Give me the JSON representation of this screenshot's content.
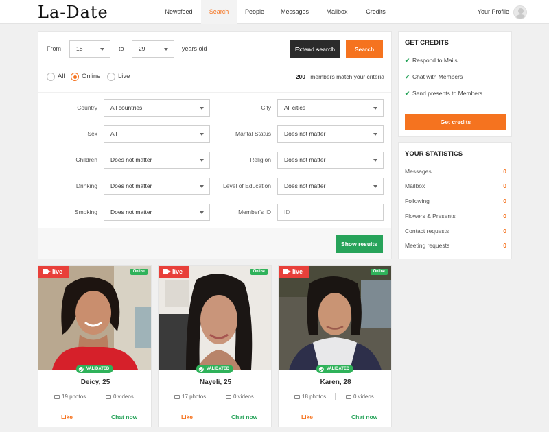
{
  "brand": {
    "logo": "La-Date"
  },
  "nav": {
    "items": [
      {
        "label": "Newsfeed",
        "active": false
      },
      {
        "label": "Search",
        "active": true
      },
      {
        "label": "People",
        "active": false
      },
      {
        "label": "Messages",
        "active": false
      },
      {
        "label": "Mailbox",
        "active": false
      },
      {
        "label": "Credits",
        "active": false
      }
    ],
    "profile_label": "Your Profile"
  },
  "search": {
    "from_label": "From",
    "age_from": "18",
    "to_label": "to",
    "age_to": "29",
    "years_label": "years old",
    "extend_button": "Extend search",
    "search_button": "Search",
    "status_options": [
      {
        "label": "All",
        "checked": false
      },
      {
        "label": "Online",
        "checked": true
      },
      {
        "label": "Live",
        "checked": false
      }
    ],
    "match_count": "200+",
    "match_text": "members match your criteria",
    "filters": {
      "country": {
        "label": "Country",
        "value": "All countries"
      },
      "city": {
        "label": "City",
        "value": "All cities"
      },
      "sex": {
        "label": "Sex",
        "value": "All"
      },
      "marital": {
        "label": "Marital Status",
        "value": "Does not matter"
      },
      "children": {
        "label": "Children",
        "value": "Does not matter"
      },
      "religion": {
        "label": "Religion",
        "value": "Does not matter"
      },
      "drinking": {
        "label": "Drinking",
        "value": "Does not matter"
      },
      "education": {
        "label": "Level of Education",
        "value": "Does not matter"
      },
      "smoking": {
        "label": "Smoking",
        "value": "Does not matter"
      },
      "member_id": {
        "label": "Member's ID",
        "placeholder": "ID"
      }
    },
    "show_results_button": "Show results"
  },
  "credits": {
    "title": "GET CREDITS",
    "items": [
      "Respond to Mails",
      "Chat with Members",
      "Send presents to Members"
    ],
    "button": "Get credits"
  },
  "stats": {
    "title": "YOUR STATISTICS",
    "rows": [
      {
        "label": "Messages",
        "value": "0"
      },
      {
        "label": "Mailbox",
        "value": "0"
      },
      {
        "label": "Following",
        "value": "0"
      },
      {
        "label": "Flowers & Presents",
        "value": "0"
      },
      {
        "label": "Contact requests",
        "value": "0"
      },
      {
        "label": "Meeting requests",
        "value": "0"
      }
    ]
  },
  "profiles": [
    {
      "live": "live",
      "online": "Online",
      "validated": "VALIDATED",
      "name": "Deicy, 25",
      "photos": "19 photos",
      "videos": "0 videos",
      "like": "Like",
      "chat": "Chat now"
    },
    {
      "live": "live",
      "online": "Online",
      "validated": "VALIDATED",
      "name": "Nayeli, 25",
      "photos": "17 photos",
      "videos": "0 videos",
      "like": "Like",
      "chat": "Chat now"
    },
    {
      "live": "live",
      "online": "Online",
      "validated": "VALIDATED",
      "name": "Karen, 28",
      "photos": "18 photos",
      "videos": "0 videos",
      "like": "Like",
      "chat": "Chat now"
    }
  ],
  "colors": {
    "accent": "#f5731f",
    "success": "#27a35a",
    "live": "#e8403a",
    "dark_button": "#2b2b2b"
  }
}
